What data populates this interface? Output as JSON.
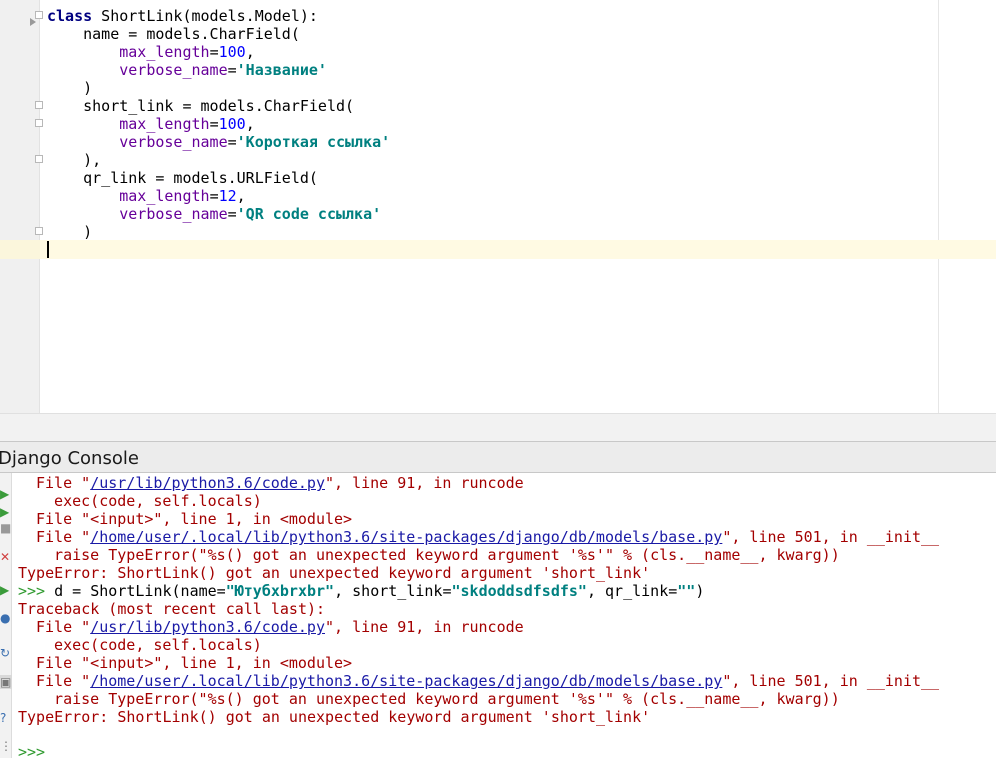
{
  "editor": {
    "lines": [
      {
        "kw": "class",
        "rest": " ShortLink(models.Model):"
      },
      {
        "text": "    name = models.CharField("
      },
      {
        "param": "        max_length",
        "eq": "=",
        "num": "100",
        "tail": ","
      },
      {
        "param": "        verbose_name",
        "eq": "=",
        "str": "'Название'"
      },
      {
        "text": "    )"
      },
      {
        "text": "    short_link = models.CharField("
      },
      {
        "param": "        max_length",
        "eq": "=",
        "num": "100",
        "tail": ","
      },
      {
        "param": "        verbose_name",
        "eq": "=",
        "str": "'Короткая ссылка'"
      },
      {
        "text": "    ),"
      },
      {
        "text": "    qr_link = models.URLField("
      },
      {
        "param": "        max_length",
        "eq": "=",
        "num": "12",
        "tail": ","
      },
      {
        "param": "        verbose_name",
        "eq": "=",
        "str": "'QR code ссылка'"
      },
      {
        "text": "    )"
      }
    ]
  },
  "console": {
    "title": "Django Console",
    "lines": [
      {
        "a": "File \"",
        "link": "/usr/lib/python3.6/code.py",
        "b": "\", line 91, in runcode"
      },
      {
        "a": "  exec(code, self.locals)"
      },
      {
        "a": "File \"<input>\", line 1, in <module>"
      },
      {
        "a": "File \"",
        "link": "/home/user/.local/lib/python3.6/site-packages/django/db/models/base.py",
        "b": "\", line 501, in __init__"
      },
      {
        "a": "  raise TypeError(\"%s() got an unexpected keyword argument '%s'\" % (cls.__name__, kwarg))"
      },
      {
        "a": "TypeError: ShortLink() got an unexpected keyword argument 'short_link'"
      },
      {
        "prompt": ">>> ",
        "p1": "d = ShortLink(name=",
        "s1": "\"Ютубхbrxbr\"",
        "p2": ", short_link=",
        "s2": "\"skdoddsdfsdfs\"",
        "p3": ", qr_link=",
        "s3": "\"\"",
        "p4": ")"
      },
      {
        "a": "Traceback (most recent call last):"
      },
      {
        "a": "File \"",
        "link": "/usr/lib/python3.6/code.py",
        "b": "\", line 91, in runcode"
      },
      {
        "a": "  exec(code, self.locals)"
      },
      {
        "a": "File \"<input>\", line 1, in <module>"
      },
      {
        "a": "File \"",
        "link": "/home/user/.local/lib/python3.6/site-packages/django/db/models/base.py",
        "b": "\", line 501, in __init__"
      },
      {
        "a": "  raise TypeError(\"%s() got an unexpected keyword argument '%s'\" % (cls.__name__, kwarg))"
      },
      {
        "a": "TypeError: ShortLink() got an unexpected keyword argument 'short_link'"
      }
    ],
    "final_prompt": ">>>"
  },
  "colors": {
    "keyword": "#000080",
    "param": "#660099",
    "number": "#0000ff",
    "string": "#008080",
    "error": "#a30000",
    "link": "#1a1aa6",
    "prompt": "#2f9a2f",
    "caret_line": "#fffae3"
  },
  "toolbar_icons": [
    "rerun-icon",
    "stop-icon",
    "execute-icon",
    "close-icon",
    "run-icon",
    "debug-icon",
    "settings-icon",
    "refresh-icon",
    "history-icon",
    "help-icon",
    "soft-wrap-icon"
  ]
}
